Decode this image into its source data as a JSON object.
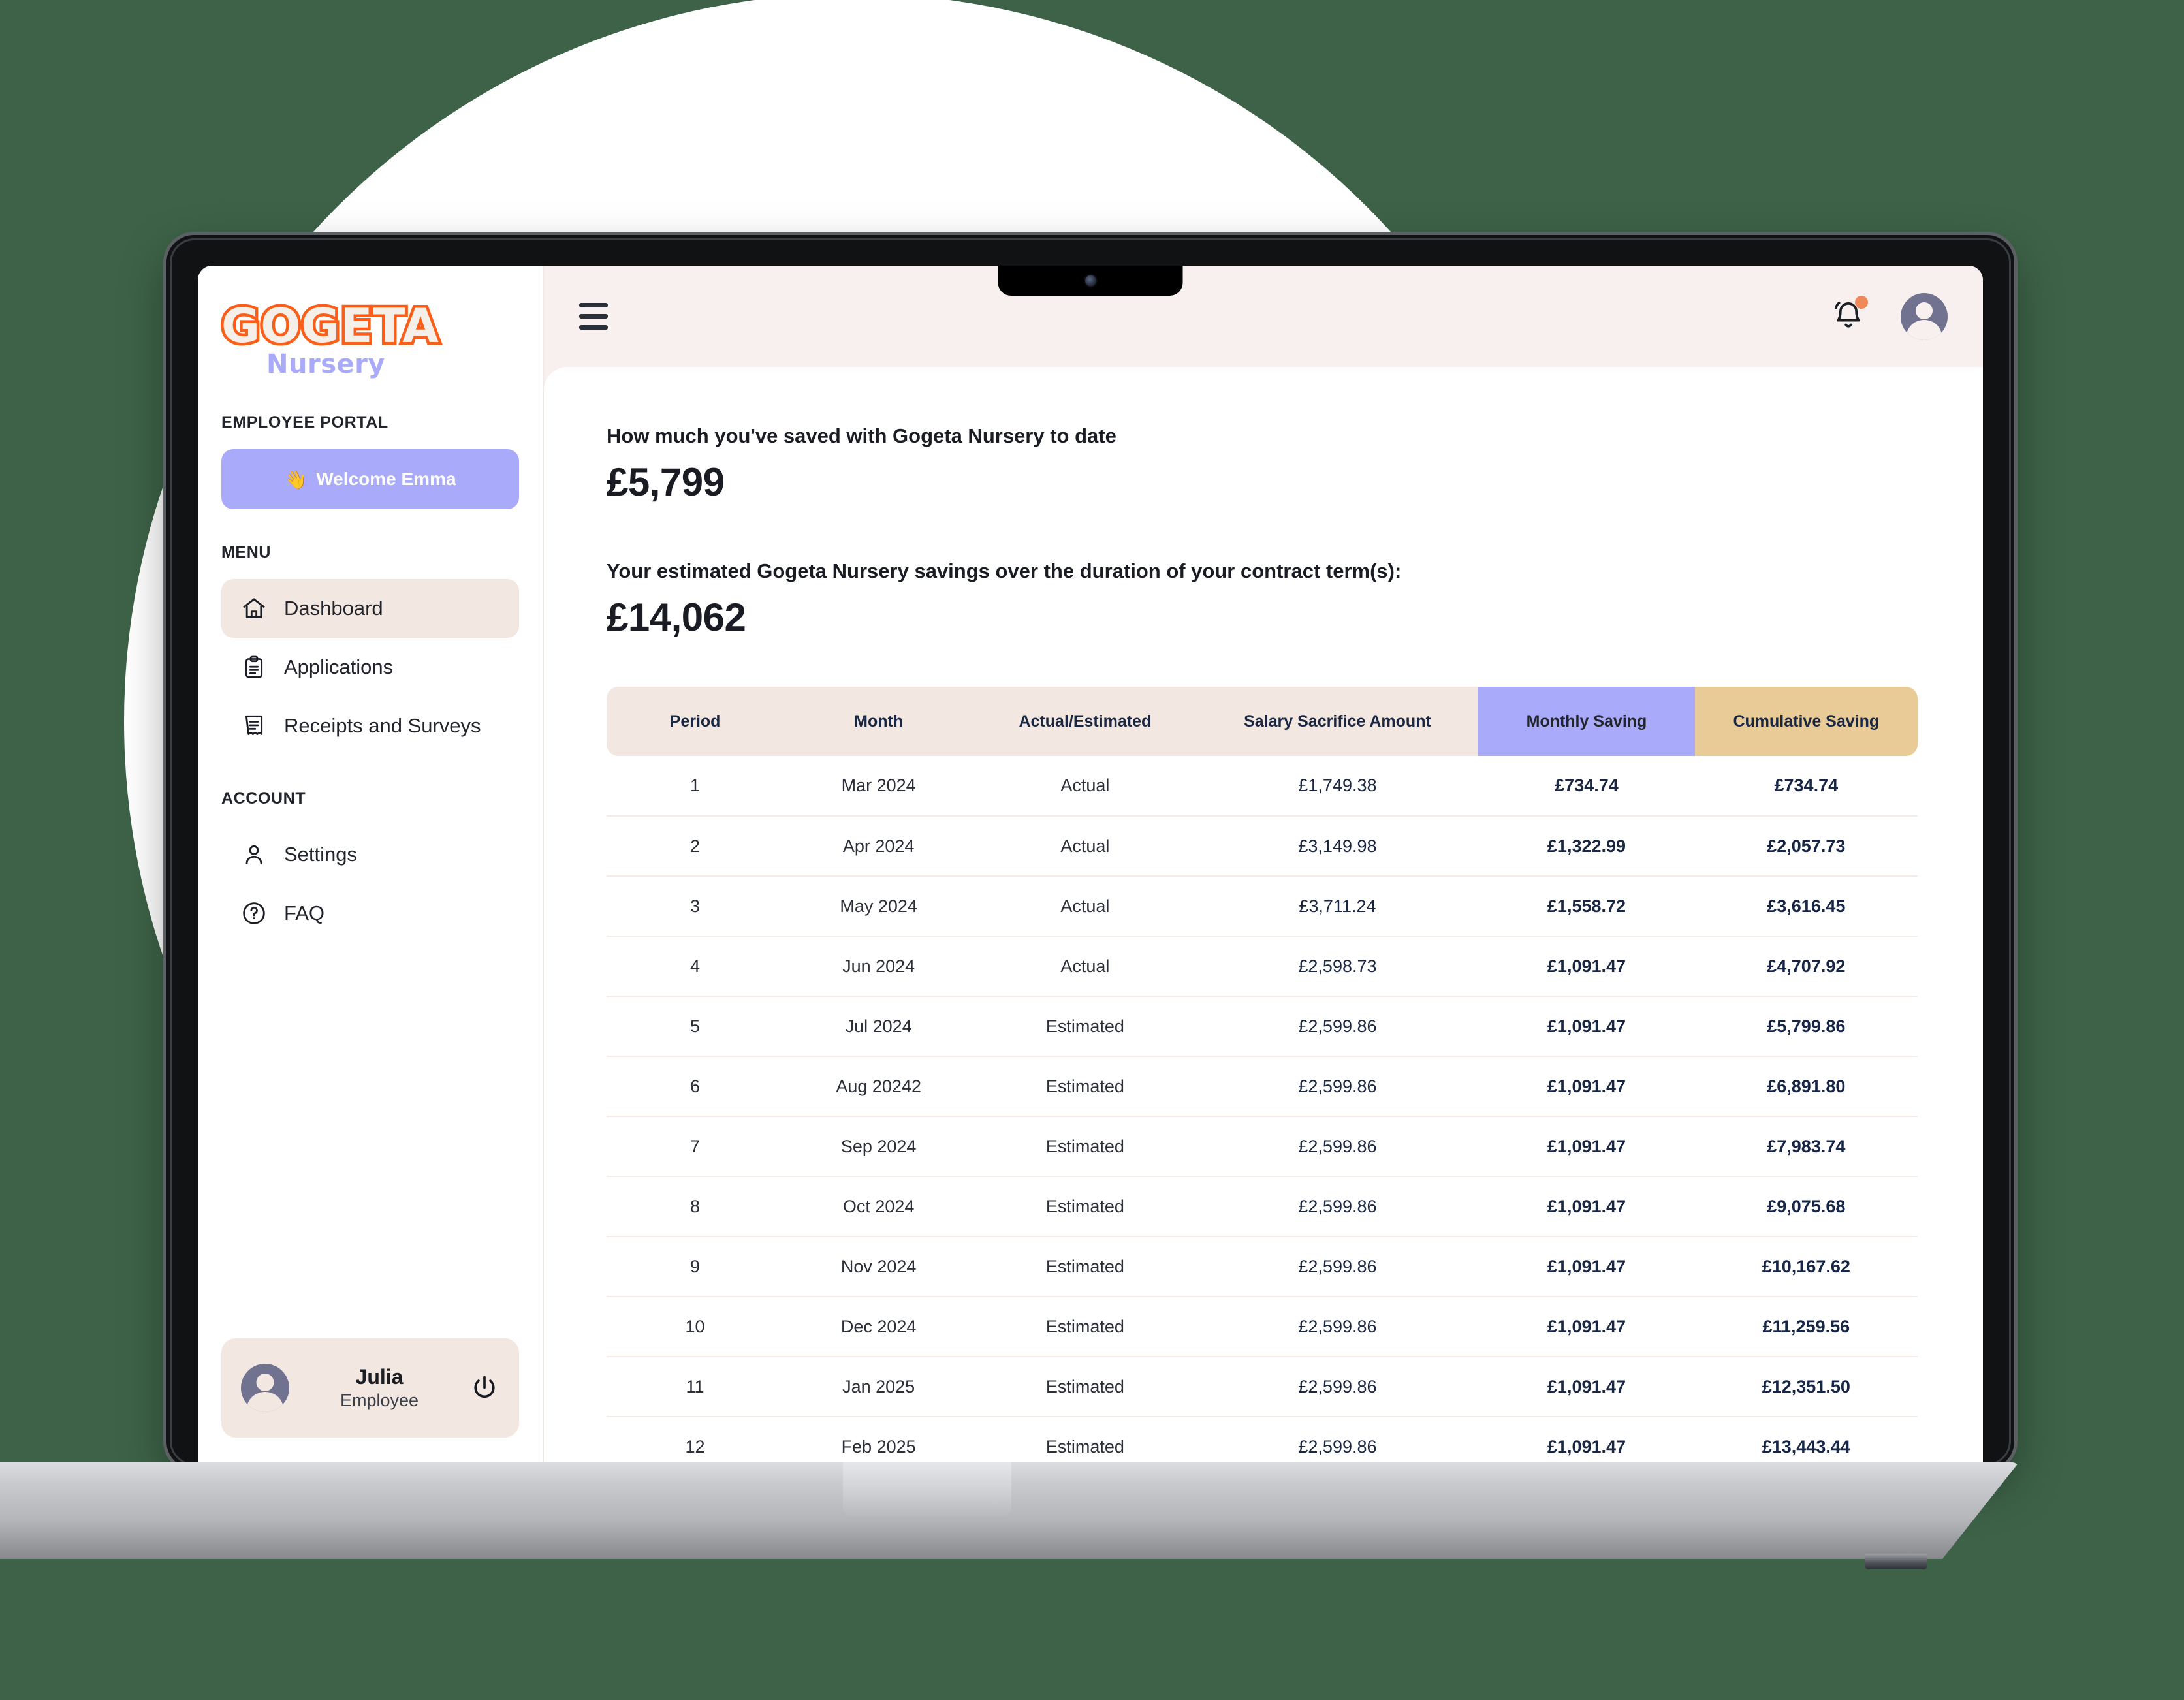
{
  "brand": {
    "logo_main": "GOGETA",
    "logo_sub": "Nursery"
  },
  "sidebar": {
    "portal_label": "EMPLOYEE PORTAL",
    "welcome_emoji": "👋",
    "welcome_label": "Welcome Emma",
    "menu_title": "MENU",
    "menu_items": [
      {
        "label": "Dashboard",
        "icon": "home-icon",
        "active": true
      },
      {
        "label": "Applications",
        "icon": "clipboard-icon",
        "active": false
      },
      {
        "label": "Receipts and Surveys",
        "icon": "receipt-icon",
        "active": false
      }
    ],
    "account_title": "ACCOUNT",
    "account_items": [
      {
        "label": "Settings",
        "icon": "person-icon"
      },
      {
        "label": "FAQ",
        "icon": "question-circle-icon"
      }
    ],
    "user_card": {
      "name": "Julia",
      "role": "Employee",
      "avatar_icon": "avatar-icon",
      "logout_icon": "power-icon"
    }
  },
  "topbar": {
    "menu_icon": "hamburger-icon",
    "bell_icon": "bell-icon",
    "has_notification": true,
    "avatar_icon": "avatar-icon"
  },
  "main": {
    "kpi_1": {
      "label": "How much you've saved with Gogeta Nursery to date",
      "value": "£5,799"
    },
    "kpi_2": {
      "label": "Your estimated Gogeta Nursery savings over the duration of your contract term(s):",
      "value": "£14,062"
    }
  },
  "colors": {
    "brand_orange": "#FB5E18",
    "periwinkle": "#AAAAFA",
    "tan": "#E8CB97",
    "blush": "#F2E7E1",
    "page_bg": "#F7F0EE",
    "navy_text": "#1A2742",
    "backdrop_green": "#3D6247"
  },
  "chart_data": {
    "type": "table",
    "title": "Savings schedule by period",
    "columns": [
      "Period",
      "Month",
      "Actual/Estimated",
      "Salary Sacrifice Amount",
      "Monthly Saving",
      "Cumulative Saving"
    ],
    "rows": [
      [
        "1",
        "Mar 2024",
        "Actual",
        "£1,749.38",
        "£734.74",
        "£734.74"
      ],
      [
        "2",
        "Apr 2024",
        "Actual",
        "£3,149.98",
        "£1,322.99",
        "£2,057.73"
      ],
      [
        "3",
        "May 2024",
        "Actual",
        "£3,711.24",
        "£1,558.72",
        "£3,616.45"
      ],
      [
        "4",
        "Jun 2024",
        "Actual",
        "£2,598.73",
        "£1,091.47",
        "£4,707.92"
      ],
      [
        "5",
        "Jul 2024",
        "Estimated",
        "£2,599.86",
        "£1,091.47",
        "£5,799.86"
      ],
      [
        "6",
        "Aug 20242",
        "Estimated",
        "£2,599.86",
        "£1,091.47",
        "£6,891.80"
      ],
      [
        "7",
        "Sep 2024",
        "Estimated",
        "£2,599.86",
        "£1,091.47",
        "£7,983.74"
      ],
      [
        "8",
        "Oct 2024",
        "Estimated",
        "£2,599.86",
        "£1,091.47",
        "£9,075.68"
      ],
      [
        "9",
        "Nov 2024",
        "Estimated",
        "£2,599.86",
        "£1,091.47",
        "£10,167.62"
      ],
      [
        "10",
        "Dec 2024",
        "Estimated",
        "£2,599.86",
        "£1,091.47",
        "£11,259.56"
      ],
      [
        "11",
        "Jan 2025",
        "Estimated",
        "£2,599.86",
        "£1,091.47",
        "£12,351.50"
      ],
      [
        "12",
        "Feb 2025",
        "Estimated",
        "£2,599.86",
        "£1,091.47",
        "£13,443.44"
      ]
    ],
    "series": [
      {
        "name": "Salary Sacrifice Amount",
        "values": [
          1749.38,
          3149.98,
          3711.24,
          2598.73,
          2599.86,
          2599.86,
          2599.86,
          2599.86,
          2599.86,
          2599.86,
          2599.86,
          2599.86
        ]
      },
      {
        "name": "Monthly Saving",
        "values": [
          734.74,
          1322.99,
          1558.72,
          1091.47,
          1091.47,
          1091.47,
          1091.47,
          1091.47,
          1091.47,
          1091.47,
          1091.47,
          1091.47
        ]
      },
      {
        "name": "Cumulative Saving",
        "values": [
          734.74,
          2057.73,
          3616.45,
          4707.92,
          5799.86,
          6891.8,
          7983.74,
          9075.68,
          10167.62,
          11259.56,
          12351.5,
          13443.44
        ]
      }
    ],
    "categories": [
      "Mar 2024",
      "Apr 2024",
      "May 2024",
      "Jun 2024",
      "Jul 2024",
      "Aug 20242",
      "Sep 2024",
      "Oct 2024",
      "Nov 2024",
      "Dec 2024",
      "Jan 2025",
      "Feb 2025"
    ]
  }
}
